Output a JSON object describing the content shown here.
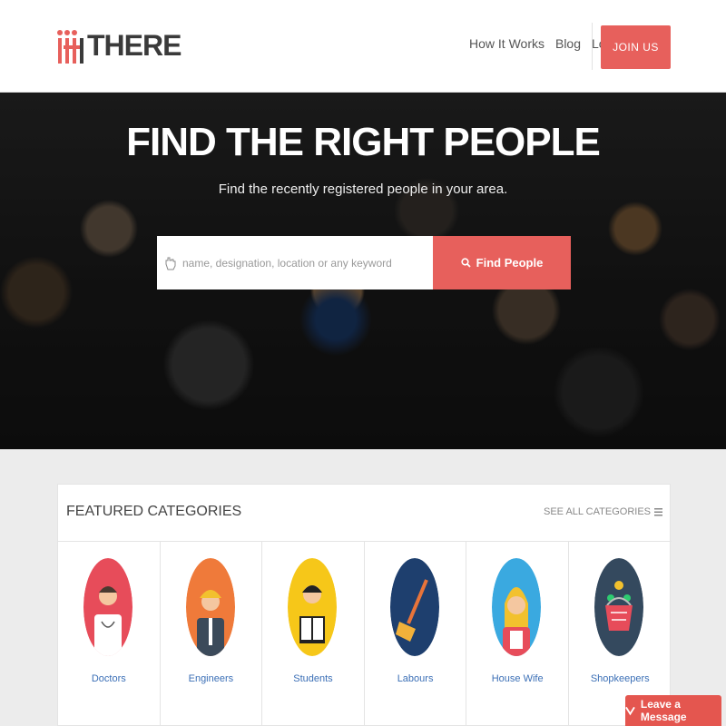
{
  "brand": {
    "logo_text": "THERE",
    "accent_color": "#e7605c"
  },
  "nav": {
    "items": [
      "How It Works",
      "Blog",
      "Login"
    ],
    "join_label": "JOIN US"
  },
  "hero": {
    "title": "FIND THE RIGHT PEOPLE",
    "subtitle": "Find the recently registered people in your area.",
    "search_placeholder": "name, designation, location or any keyword",
    "search_value": "",
    "find_label": "Find People"
  },
  "featured": {
    "title": "FEATURED CATEGORIES",
    "see_all_label": "SEE ALL CATEGORIES",
    "categories": [
      {
        "label": "Doctors",
        "icon": "doctor-icon",
        "color": "#e74c5a"
      },
      {
        "label": "Engineers",
        "icon": "engineer-icon",
        "color": "#ef7a3a"
      },
      {
        "label": "Students",
        "icon": "student-icon",
        "color": "#f6c719"
      },
      {
        "label": "Labours",
        "icon": "broom-icon",
        "color": "#1e3f6e"
      },
      {
        "label": "House Wife",
        "icon": "housewife-icon",
        "color": "#3aa9e0"
      },
      {
        "label": "Shopkeepers",
        "icon": "basket-icon",
        "color": "#34495e"
      }
    ]
  },
  "chat": {
    "label": "Leave a Message"
  }
}
